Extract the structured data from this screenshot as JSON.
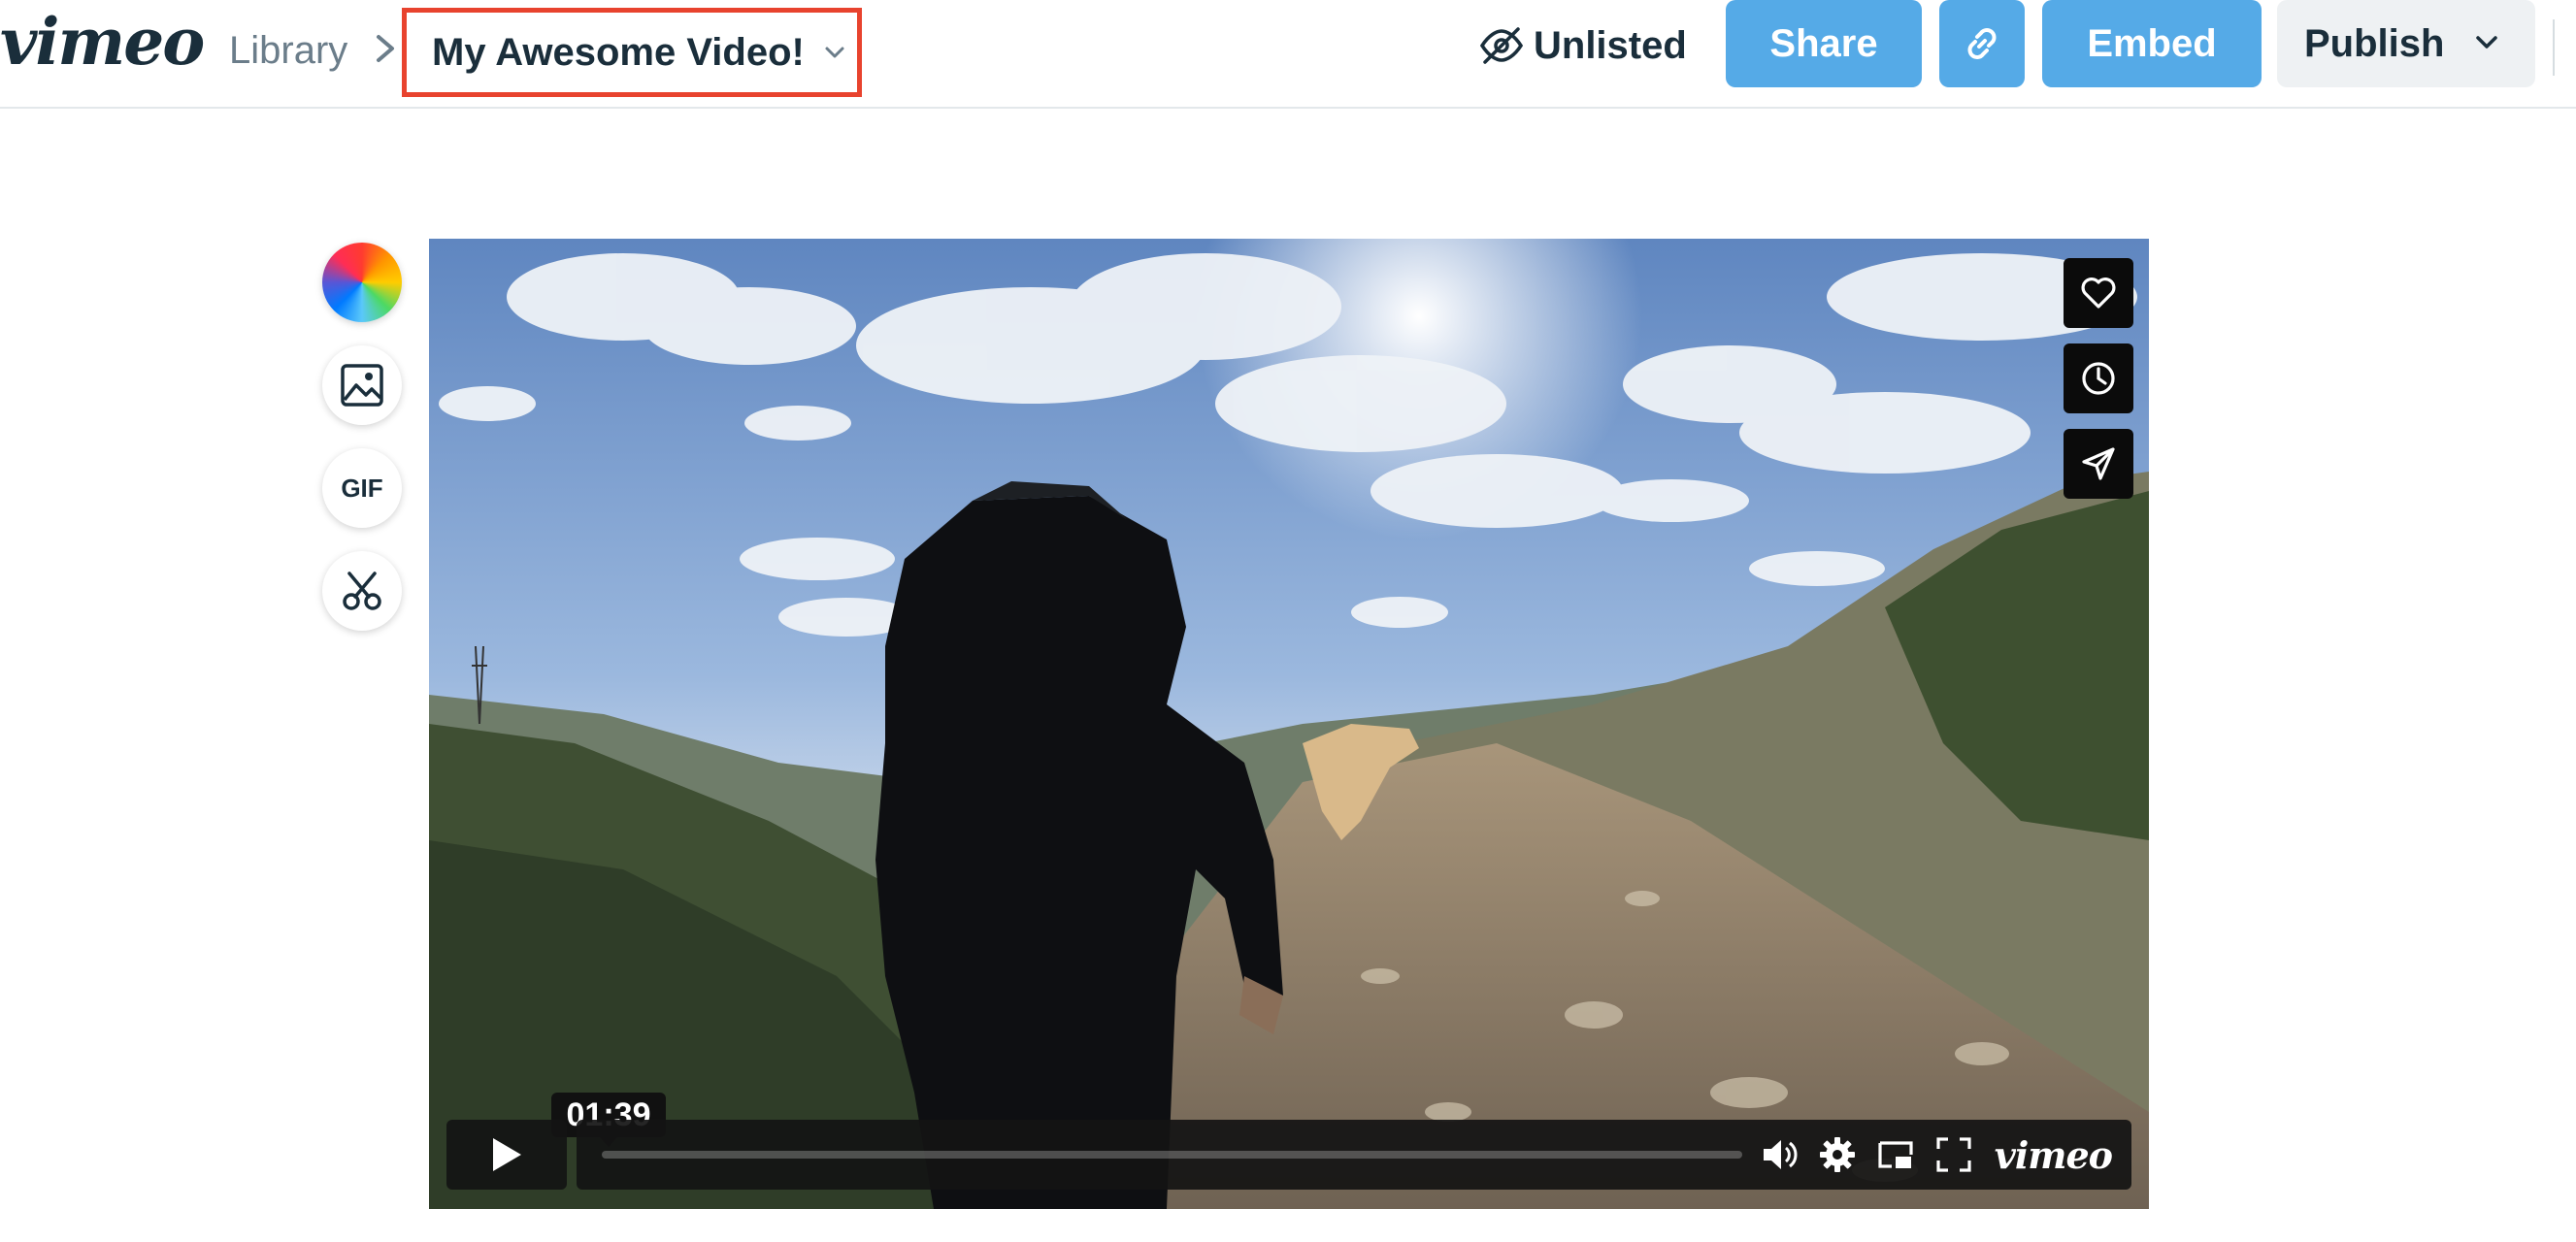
{
  "header": {
    "logo_text": "vimeo",
    "breadcrumb_library": "Library",
    "video_title": "My Awesome Video!",
    "privacy_label": "Unlisted",
    "share_label": "Share",
    "embed_label": "Embed",
    "publish_label": "Publish"
  },
  "tools": {
    "gif_label": "GIF"
  },
  "player": {
    "timestamp": "01:39",
    "progress_fraction": 0,
    "logo_text": "vimeo"
  },
  "colors": {
    "accent_blue": "#55aae7",
    "highlight_red": "#e8432e",
    "text_dark": "#1a2e3b"
  },
  "icons": [
    "chevron-right-icon",
    "chevron-down-icon",
    "eye-slash-icon",
    "link-icon",
    "color-wheel-icon",
    "image-icon",
    "scissors-icon",
    "heart-icon",
    "clock-icon",
    "paper-plane-icon",
    "play-icon",
    "volume-icon",
    "gear-icon",
    "pip-icon",
    "fullscreen-icon"
  ]
}
